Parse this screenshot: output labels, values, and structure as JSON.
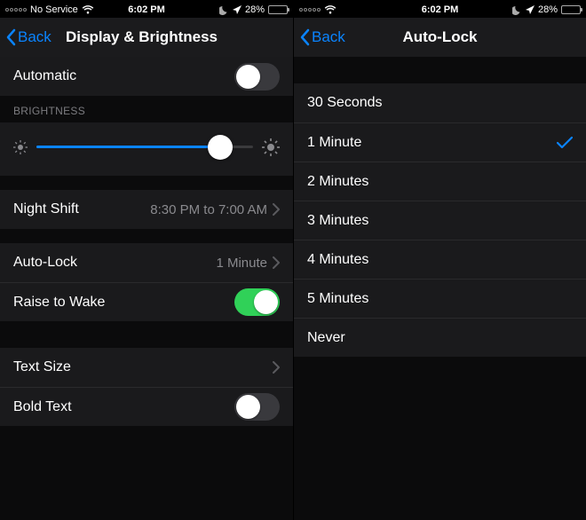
{
  "status": {
    "carrier": "No Service",
    "time": "6:02 PM",
    "battery_pct": "28%",
    "battery_fill_pct": 28
  },
  "left": {
    "back_label": "Back",
    "title": "Display & Brightness",
    "rows": {
      "automatic": {
        "label": "Automatic",
        "on": false
      },
      "brightness_header": "BRIGHTNESS",
      "brightness_pct": 85,
      "night_shift": {
        "label": "Night Shift",
        "detail": "8:30 PM to 7:00 AM"
      },
      "auto_lock": {
        "label": "Auto-Lock",
        "detail": "1 Minute"
      },
      "raise_to_wake": {
        "label": "Raise to Wake",
        "on": true
      },
      "text_size": {
        "label": "Text Size"
      },
      "bold_text": {
        "label": "Bold Text",
        "on": false
      }
    }
  },
  "right": {
    "back_label": "Back",
    "title": "Auto-Lock",
    "selected": 1,
    "options": [
      "30 Seconds",
      "1 Minute",
      "2 Minutes",
      "3 Minutes",
      "4 Minutes",
      "5 Minutes",
      "Never"
    ]
  }
}
